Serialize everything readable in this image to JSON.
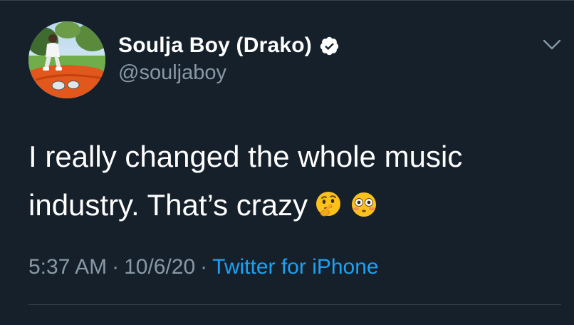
{
  "author": {
    "display_name": "Soulja Boy (Drako)",
    "handle": "@souljaboy",
    "verified": true,
    "avatar_icon": "user-avatar-photo"
  },
  "tweet": {
    "line1": "I really changed the whole music",
    "line2": "industry. That’s crazy",
    "emojis": [
      "thinking-face-emoji",
      "flushed-face-emoji"
    ]
  },
  "meta": {
    "time": "5:37 AM",
    "separator": "·",
    "date": "10/6/20",
    "source": "Twitter for iPhone"
  },
  "colors": {
    "background": "#15202b",
    "text": "#ffffff",
    "secondary": "#8899a6",
    "accent": "#1da1f2",
    "divider": "#38444d"
  }
}
